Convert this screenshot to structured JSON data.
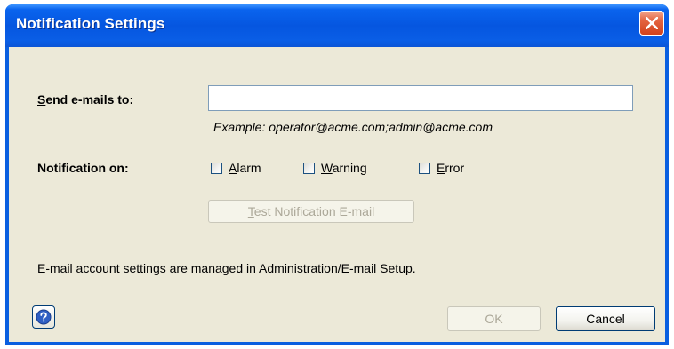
{
  "window": {
    "title": "Notification Settings"
  },
  "form": {
    "send_label_first": "S",
    "send_label_rest": "end e-mails to:",
    "email_value": "",
    "example_text": "Example:  operator@acme.com;admin@acme.com",
    "notification_label": "Notification on:",
    "checkboxes": [
      {
        "first": "A",
        "rest": "larm",
        "checked": false
      },
      {
        "first": "W",
        "rest": "arning",
        "checked": false
      },
      {
        "first": "E",
        "rest": "rror",
        "checked": false
      }
    ],
    "test_button_first": "T",
    "test_button_rest": "est Notification E-mail",
    "info_text": "E-mail account settings are managed in Administration/E-mail Setup."
  },
  "footer": {
    "ok_label": "OK",
    "cancel_label": "Cancel"
  },
  "icons": {
    "close": "close-icon",
    "help": "help-icon"
  }
}
